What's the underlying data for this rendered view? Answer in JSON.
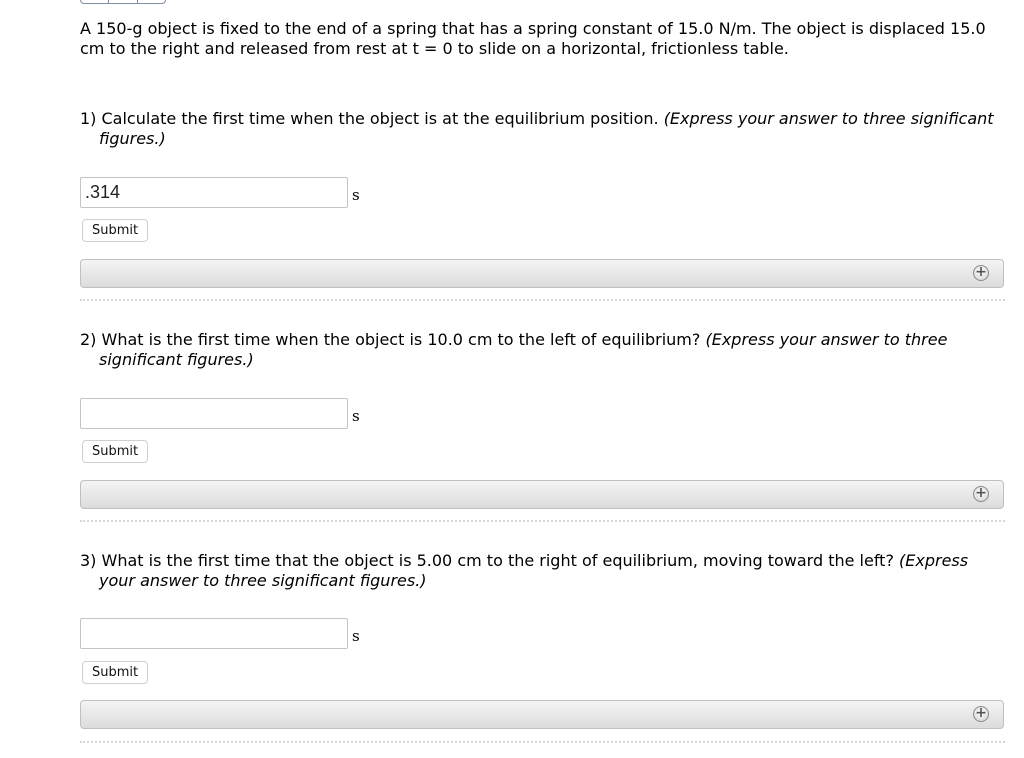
{
  "intro": "A 150-g object is fixed to the end of a spring that has a spring constant of 15.0 N/m. The object is displaced 15.0 cm to the right and released from rest at t = 0 to slide on a horizontal, frictionless table.",
  "questions": [
    {
      "text": "1) Calculate the first time when the object is at the equilibrium position.",
      "hint": "(Express your answer to three significant figures.)",
      "answer_value": ".314",
      "unit": "s",
      "submit_label": "Submit"
    },
    {
      "text": "2) What is the first time when the object is 10.0 cm to the left of equilibrium?",
      "hint": "(Express your answer to three significant figures.)",
      "answer_value": "",
      "unit": "s",
      "submit_label": "Submit"
    },
    {
      "text": "3) What is the first time that the object is 5.00 cm to the right of equilibrium, moving toward the left?",
      "hint": "(Express your answer to three significant figures.)",
      "answer_value": "",
      "unit": "s",
      "submit_label": "Submit"
    }
  ],
  "icons": {
    "expand": "plus-circle-icon"
  }
}
